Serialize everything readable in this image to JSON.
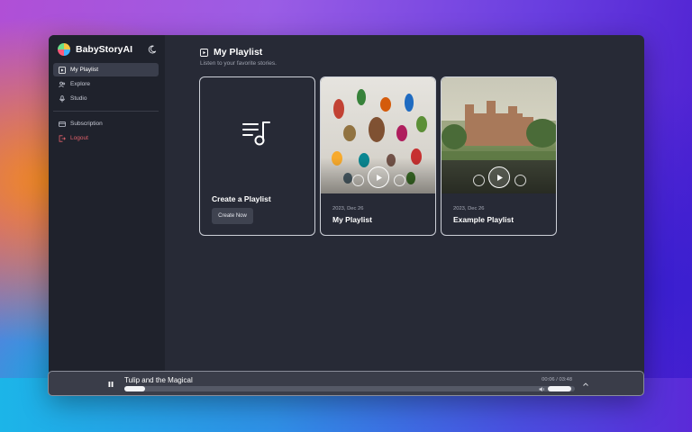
{
  "app": {
    "name": "BabyStoryAI"
  },
  "sidebar": {
    "items": [
      {
        "label": "My Playlist",
        "icon": "playlist-icon",
        "active": true
      },
      {
        "label": "Explore",
        "icon": "users-icon",
        "active": false
      },
      {
        "label": "Studio",
        "icon": "mic-icon",
        "active": false
      }
    ],
    "secondary": [
      {
        "label": "Subscription",
        "icon": "card-icon"
      },
      {
        "label": "Logout",
        "icon": "logout-icon"
      }
    ]
  },
  "main": {
    "title": "My Playlist",
    "subtitle": "Listen to your favorite stories."
  },
  "create_card": {
    "title": "Create a Playlist",
    "button_label": "Create Now"
  },
  "playlists": [
    {
      "date": "2023, Dec 26",
      "title": "My Playlist"
    },
    {
      "date": "2023, Dec 26",
      "title": "Example Playlist"
    }
  ],
  "player": {
    "track_title": "Tulip and the Magical",
    "time_display": "00:06 / 03:48",
    "progress_fraction": 0.045,
    "volume_fraction": 0.9
  },
  "colors": {
    "accent_logout": "#e0606a",
    "surface": "#272a36",
    "sidebar": "#1f222c"
  }
}
